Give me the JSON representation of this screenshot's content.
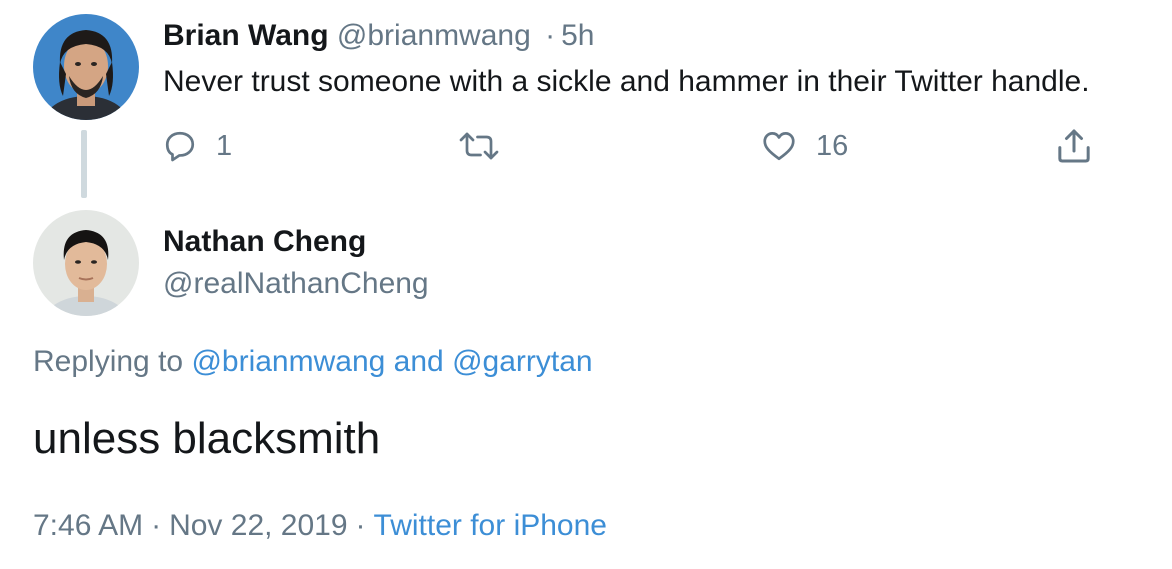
{
  "original_tweet": {
    "author_name": "Brian Wang",
    "author_handle": "@brianmwang",
    "separator": "·",
    "time_ago": "5h",
    "text": "Never trust someone with a sickle and hammer in their Twitter handle.",
    "actions": {
      "reply_icon": "reply-icon",
      "reply_count": "1",
      "retweet_icon": "retweet-icon",
      "like_icon": "heart-icon",
      "like_count": "16",
      "share_icon": "share-icon"
    }
  },
  "reply_tweet": {
    "author_name": "Nathan Cheng",
    "author_handle": "@realNathanCheng",
    "replying_prefix": "Replying to",
    "replying_user_1": "@brianmwang",
    "replying_and": "and",
    "replying_user_2": "@garrytan",
    "text": "unless blacksmith",
    "time": "7:46 AM",
    "separator": "·",
    "date": "Nov 22, 2019",
    "source": "Twitter for iPhone"
  },
  "colors": {
    "text": "#14171a",
    "muted": "#657786",
    "link": "#3c8ed6",
    "thread_line": "#cfd9de"
  }
}
